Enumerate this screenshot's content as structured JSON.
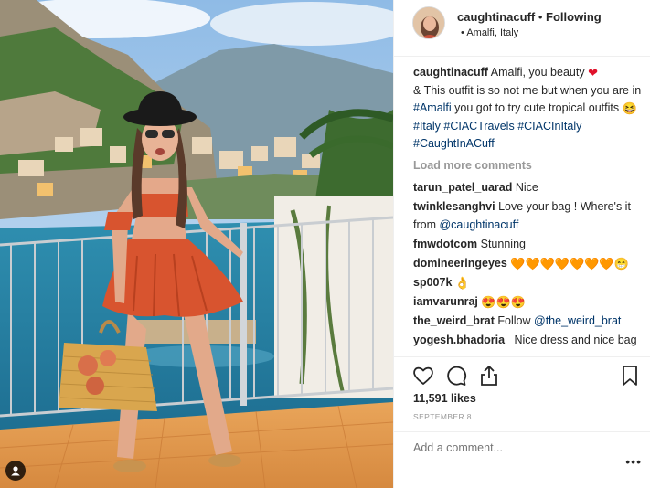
{
  "post": {
    "username": "caughtinacuff",
    "follow_state": "Following",
    "separator": "•",
    "location_bullet": "•",
    "location": "Amalfi, Italy"
  },
  "caption": {
    "username": "caughtinacuff",
    "text_1": "Amalfi, you beauty",
    "text_2": "& This outfit is so not me but when you are in",
    "hashtag_amalfi": "#Amalfi",
    "text_3": "you got to try cute tropical outfits",
    "hashtags": [
      "#Italy",
      "#CIACTravels",
      "#CIACInItaly",
      "#CaughtInACuff"
    ]
  },
  "load_more_label": "Load more comments",
  "comments": [
    {
      "user": "tarun_patel_uarad",
      "text": "Nice"
    },
    {
      "user": "twinklesanghvi",
      "text": "Love your bag ! Where's it from",
      "mention": "@caughtinacuff"
    },
    {
      "user": "fmwdotcom",
      "text": "Stunning"
    },
    {
      "user": "domineeringeyes",
      "emoji": "🧡🧡🧡🧡🧡🧡🧡😁"
    },
    {
      "user": "sp007k",
      "emoji": "👌"
    },
    {
      "user": "iamvarunraj",
      "emoji": "😍😍😍"
    },
    {
      "user": "the_weird_brat",
      "text": "Follow",
      "mention": "@the_weird_brat"
    },
    {
      "user": "yogesh.bhadoria_",
      "text": "Nice dress and nice bag"
    }
  ],
  "likes_label": "11,591 likes",
  "date_label": "SEPTEMBER 8",
  "add_comment_placeholder": "Add a comment...",
  "more_label": "•••",
  "icons": {
    "like": "heart-icon",
    "comment": "comment-icon",
    "share": "share-icon",
    "save": "bookmark-icon",
    "user_tag": "user-tag-icon"
  },
  "colors": {
    "link": "#003569",
    "muted": "#999999",
    "text": "#262626",
    "dress": "#d8542f"
  }
}
